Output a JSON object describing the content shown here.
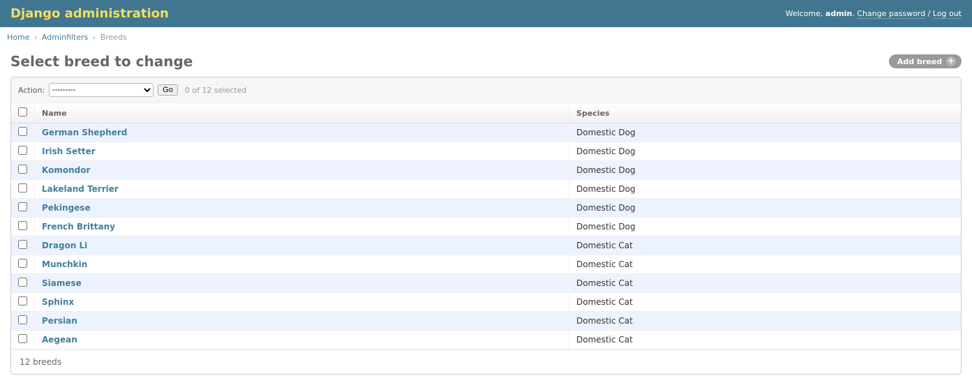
{
  "header": {
    "branding": "Django administration",
    "welcome_prefix": "Welcome, ",
    "username": "admin",
    "welcome_suffix": ".",
    "change_password": "Change password",
    "sep": " / ",
    "logout": "Log out"
  },
  "breadcrumb": {
    "home": "Home",
    "app": "Adminfilters",
    "current": "Breeds",
    "sep": "›"
  },
  "page_title": "Select breed to change",
  "add_button": "Add breed",
  "actions": {
    "label": "Action:",
    "placeholder_option": "---------",
    "go": "Go",
    "counter": "0 of 12 selected"
  },
  "columns": {
    "name": "Name",
    "species": "Species"
  },
  "rows": [
    {
      "name": "German Shepherd",
      "species": "Domestic Dog"
    },
    {
      "name": "Irish Setter",
      "species": "Domestic Dog"
    },
    {
      "name": "Komondor",
      "species": "Domestic Dog"
    },
    {
      "name": "Lakeland Terrier",
      "species": "Domestic Dog"
    },
    {
      "name": "Pekingese",
      "species": "Domestic Dog"
    },
    {
      "name": "French Brittany",
      "species": "Domestic Dog"
    },
    {
      "name": "Dragon Li",
      "species": "Domestic Cat"
    },
    {
      "name": "Munchkin",
      "species": "Domestic Cat"
    },
    {
      "name": "Siamese",
      "species": "Domestic Cat"
    },
    {
      "name": "Sphinx",
      "species": "Domestic Cat"
    },
    {
      "name": "Persian",
      "species": "Domestic Cat"
    },
    {
      "name": "Aegean",
      "species": "Domestic Cat"
    }
  ],
  "paginator": "12 breeds"
}
